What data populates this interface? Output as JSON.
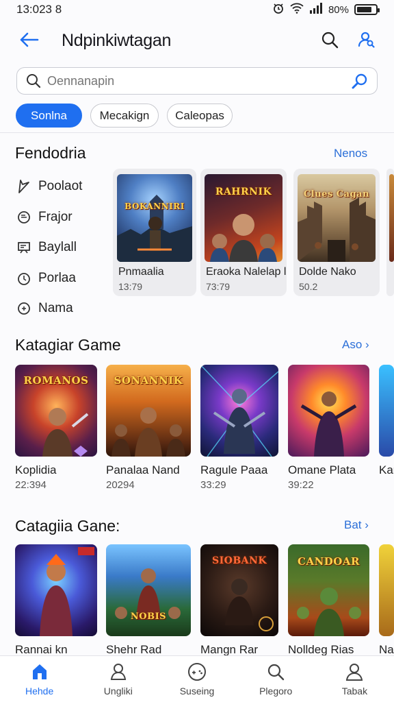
{
  "status_bar": {
    "time": "13:023 8",
    "alarm_icon": "alarm-icon",
    "wifi_icon": "wifi-icon",
    "signal_icon": "signal-icon",
    "battery_text": "80%",
    "battery_level": 0.8
  },
  "header": {
    "title": "Ndpinkiwtagan",
    "back_icon": "arrow-left-icon",
    "search_icon": "search-icon",
    "profile_icon": "user-search-icon"
  },
  "search": {
    "placeholder": "Oennanapin",
    "value": "Oennanapin",
    "icon": "search-icon",
    "go_icon": "magnifier-icon"
  },
  "chips": [
    {
      "label": "Sonlna",
      "active": true
    },
    {
      "label": "Mecakign",
      "active": false
    },
    {
      "label": "Caleopas",
      "active": false
    }
  ],
  "featured": {
    "title": "Fendodria",
    "more_label": "Nenos",
    "categories": [
      {
        "label": "Poolaot",
        "icon": "send-icon"
      },
      {
        "label": "Frajor",
        "icon": "chat-icon"
      },
      {
        "label": "Baylall",
        "icon": "board-icon"
      },
      {
        "label": "Porlaa",
        "icon": "clock-icon"
      },
      {
        "label": "Nama",
        "icon": "circle-play-icon"
      }
    ],
    "cards": [
      {
        "name": "Pnmaalia",
        "score": "13:79",
        "art_text": "BOKANNIRI"
      },
      {
        "name": "Eraoka Nalelap l",
        "score": "73:79",
        "art_text": "RAHRNIK"
      },
      {
        "name": "Dolde Nako",
        "score": "50.2",
        "art_text": "Clues Cagan"
      }
    ]
  },
  "section2": {
    "title": "Katagiar Game",
    "more_label": "Aso ›",
    "games": [
      {
        "name": "Koplidia",
        "score": "22:394",
        "art_text": "ROMANOS"
      },
      {
        "name": "Panalaa Nand",
        "score": "20294",
        "art_text": "SONANNIK"
      },
      {
        "name": "Ragule Paaa",
        "score": "33:29",
        "art_text": ""
      },
      {
        "name": "Omane Plata",
        "score": "39:22",
        "art_text": ""
      },
      {
        "name": "Kan",
        "score": "",
        "art_text": ""
      }
    ]
  },
  "section3": {
    "title": "Catagiia Gane:",
    "more_label": "Bat ›",
    "games": [
      {
        "name": "Rannai kn",
        "art_text": ""
      },
      {
        "name": "Shehr Rad",
        "art_text": "NOBIS"
      },
      {
        "name": "Mangn Rar",
        "art_text": "SIOBANK"
      },
      {
        "name": "Nolldeg Rias",
        "art_text": "CANDOAR"
      },
      {
        "name": "Na",
        "art_text": ""
      }
    ]
  },
  "bottom_nav": [
    {
      "label": "Hehde",
      "icon": "home-icon",
      "active": true
    },
    {
      "label": "Ungliki",
      "icon": "person-icon",
      "active": false
    },
    {
      "label": "Suseing",
      "icon": "gamepad-icon",
      "active": false
    },
    {
      "label": "Plegoro",
      "icon": "search-icon",
      "active": false
    },
    {
      "label": "Tabak",
      "icon": "profile-icon",
      "active": false
    }
  ],
  "colors": {
    "accent": "#1f6ff0",
    "link": "#2b6fd8",
    "background": "#fbfbfd"
  }
}
